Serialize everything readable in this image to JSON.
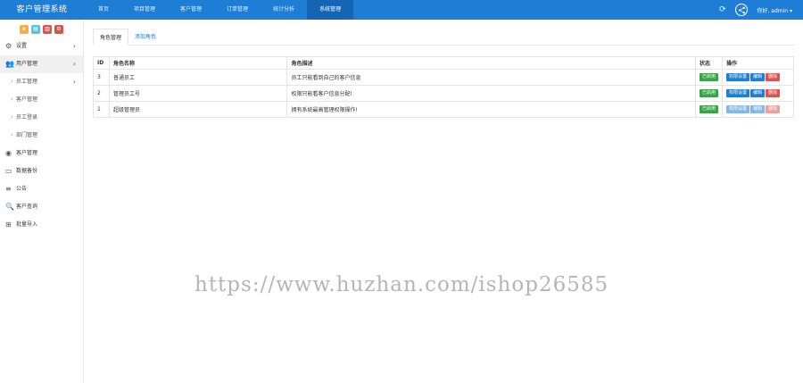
{
  "header": {
    "brand": "客户管理系统",
    "nav": [
      "首页",
      "项目管理",
      "客户管理",
      "订单管理",
      "统计分析",
      "系统管理"
    ],
    "active_index": 5,
    "user": "你好, admin ▾"
  },
  "sidebar": {
    "toolbuttons": [
      {
        "glyph": "★",
        "color": "#f0ad4e"
      },
      {
        "glyph": "▤",
        "color": "#5bc0de"
      },
      {
        "glyph": "▥",
        "color": "#d9534f"
      },
      {
        "glyph": "⚙",
        "color": "#d9534f"
      }
    ],
    "items": [
      {
        "label": "设置",
        "icon": "⚙",
        "chevron": "›"
      },
      {
        "label": "用户管理",
        "icon": "👥",
        "chevron": "›",
        "open": true
      },
      {
        "label": "员工管理",
        "sub": true,
        "chevron": "›"
      },
      {
        "label": "客户管理",
        "sub": true
      },
      {
        "label": "员工登录",
        "sub": true
      },
      {
        "label": "部门管理",
        "sub": true
      },
      {
        "label": "客户管理",
        "icon": "◉"
      },
      {
        "label": "数据备份",
        "icon": "▭"
      },
      {
        "label": "公告",
        "icon": "≡"
      },
      {
        "label": "客户查询",
        "icon": "🔍"
      },
      {
        "label": "批量导入",
        "icon": "⊞"
      }
    ]
  },
  "main": {
    "tabs": [
      "角色管理",
      "添加角色"
    ],
    "columns": [
      "ID",
      "角色名称",
      "角色描述",
      "状态",
      "操作"
    ],
    "rows": [
      {
        "id": "3",
        "name": "普通员工",
        "desc": "员工只能看到自己的客户信息",
        "status": "已启用",
        "ops": [
          "权限设置",
          "编辑",
          "删除"
        ],
        "disabled": false
      },
      {
        "id": "2",
        "name": "管理员工号",
        "desc": "权限只能看客户信息分配!",
        "status": "已启用",
        "ops": [
          "权限设置",
          "编辑",
          "删除"
        ],
        "disabled": false
      },
      {
        "id": "1",
        "name": "超级管理员",
        "desc": "拥有系统最高管理权限操作!",
        "status": "已启用",
        "ops": [
          "权限设置",
          "编辑",
          "删除"
        ],
        "disabled": true
      }
    ]
  },
  "watermark": "https://www.huzhan.com/ishop26585"
}
